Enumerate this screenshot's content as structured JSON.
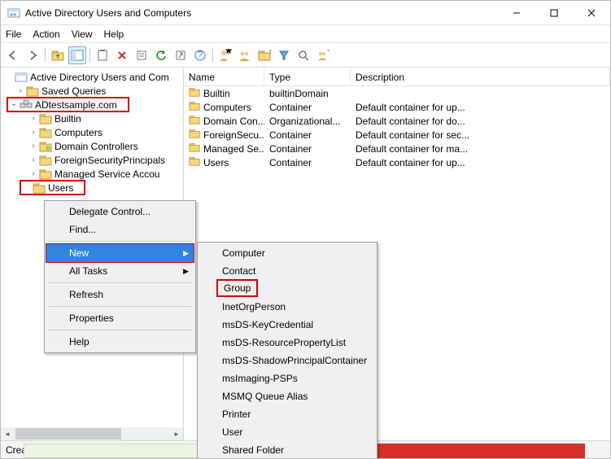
{
  "title": "Active Directory Users and Computers",
  "window_buttons": {
    "min": "min",
    "max": "max",
    "close": "close"
  },
  "menubar": [
    "File",
    "Action",
    "View",
    "Help"
  ],
  "tree": {
    "root": "Active Directory Users and Com",
    "saved_queries": "Saved Queries",
    "domain": "ADtestsample.com",
    "children": [
      "Builtin",
      "Computers",
      "Domain Controllers",
      "ForeignSecurityPrincipals",
      "Managed Service Accou",
      "Users"
    ]
  },
  "list": {
    "headers": {
      "name": "Name",
      "type": "Type",
      "desc": "Description"
    },
    "rows": [
      {
        "name": "Builtin",
        "type": "builtinDomain",
        "desc": ""
      },
      {
        "name": "Computers",
        "type": "Container",
        "desc": "Default container for up..."
      },
      {
        "name": "Domain Con...",
        "type": "Organizational...",
        "desc": "Default container for do..."
      },
      {
        "name": "ForeignSecu...",
        "type": "Container",
        "desc": "Default container for sec..."
      },
      {
        "name": "Managed Se...",
        "type": "Container",
        "desc": "Default container for ma..."
      },
      {
        "name": "Users",
        "type": "Container",
        "desc": "Default container for up..."
      }
    ]
  },
  "ctx1": {
    "items": [
      "Delegate Control...",
      "Find...",
      "New",
      "All Tasks",
      "Refresh",
      "Properties",
      "Help"
    ]
  },
  "ctx2": {
    "items": [
      "Computer",
      "Contact",
      "Group",
      "InetOrgPerson",
      "msDS-KeyCredential",
      "msDS-ResourcePropertyList",
      "msDS-ShadowPrincipalContainer",
      "msImaging-PSPs",
      "MSMQ Queue Alias",
      "Printer",
      "User",
      "Shared Folder"
    ]
  },
  "status": "Creates a new item in this container.",
  "chart_data": null
}
